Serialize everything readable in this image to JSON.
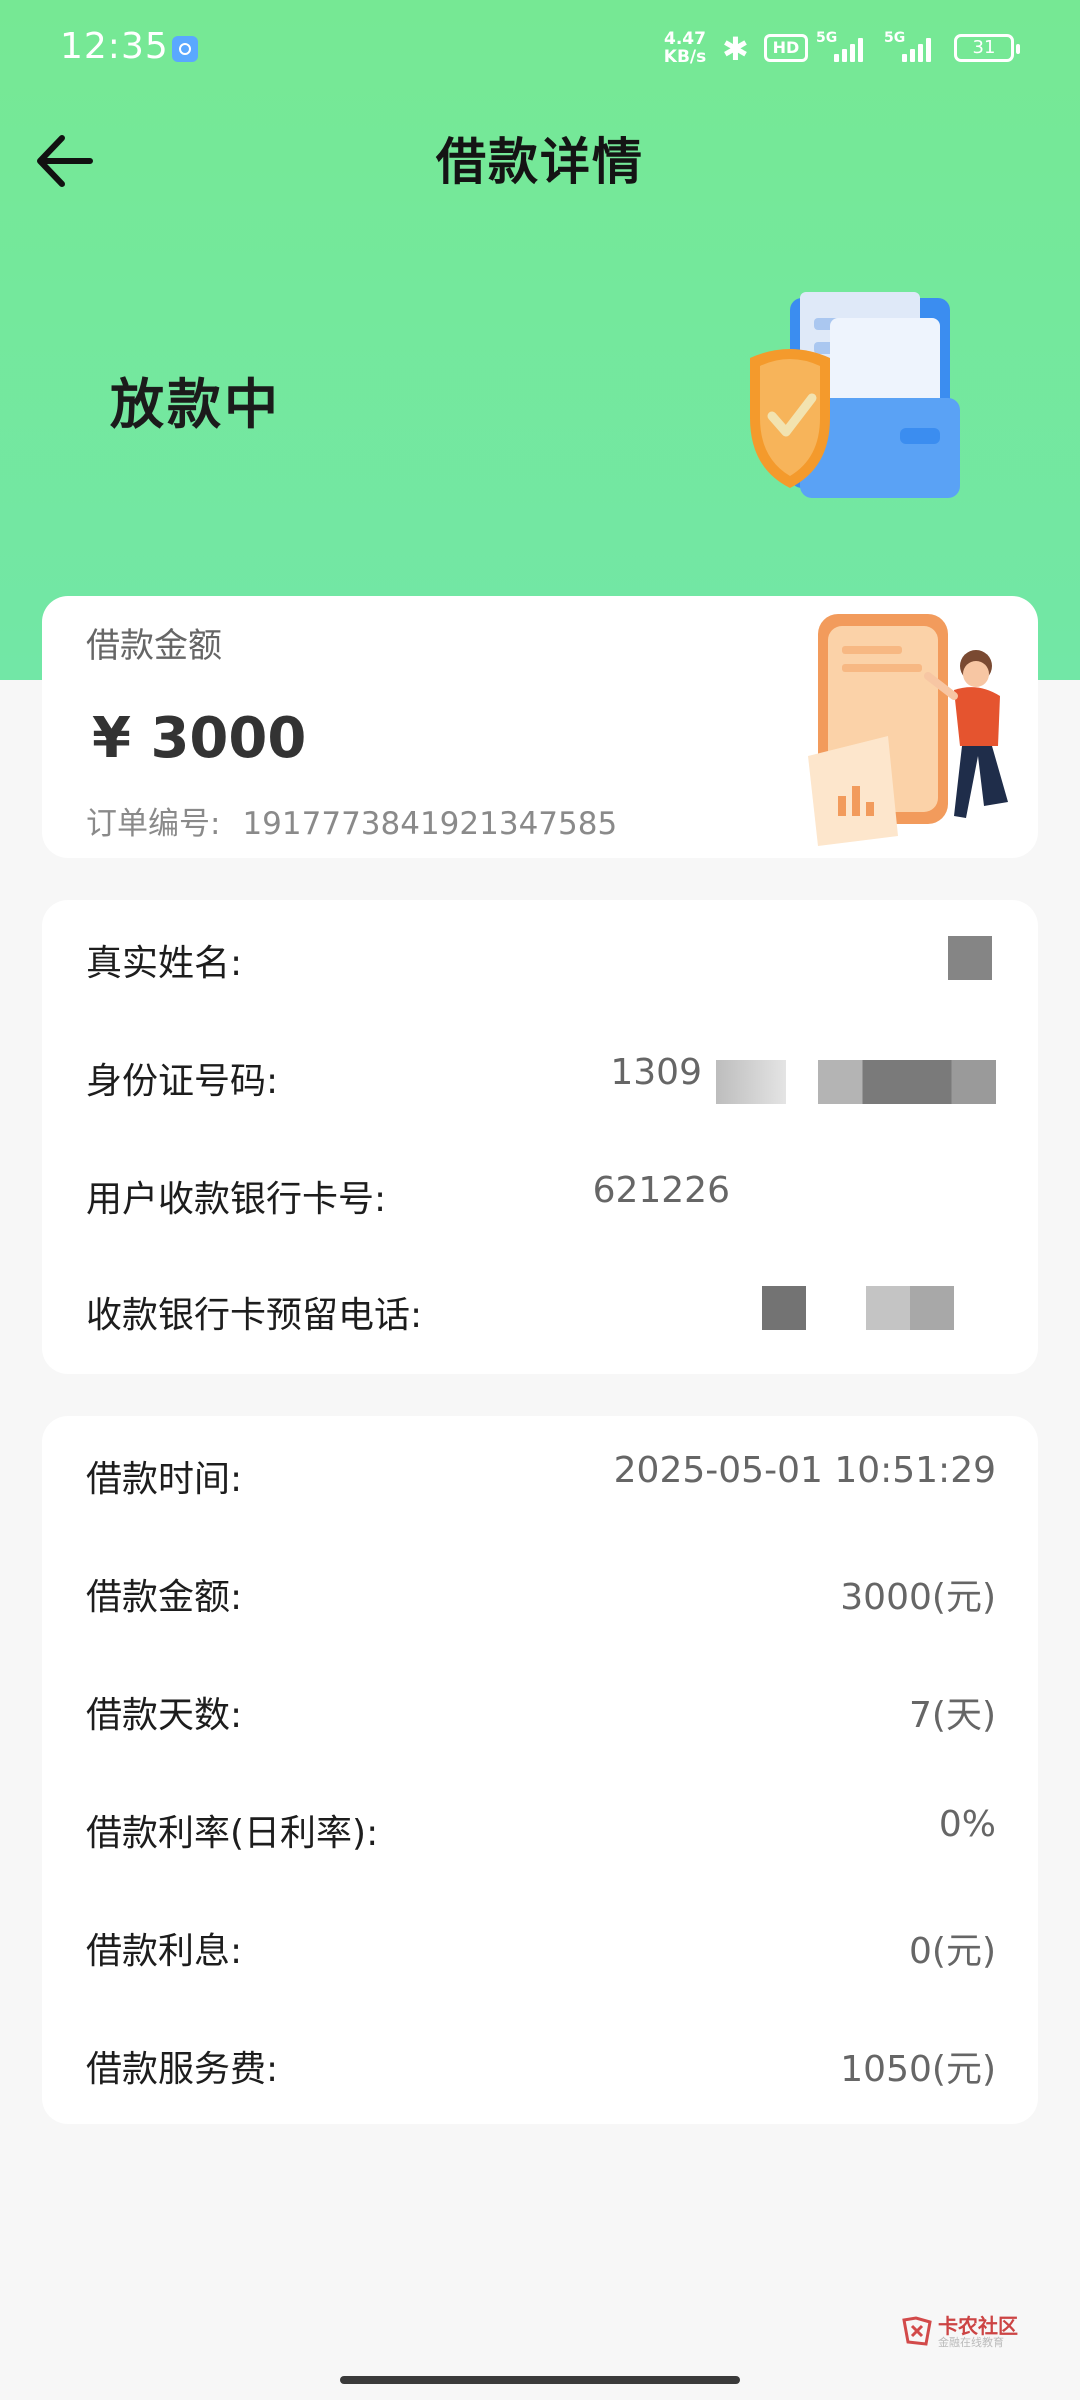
{
  "status_bar": {
    "time": "12:35",
    "net_speed_value": "4.47",
    "net_speed_unit": "KB/s",
    "hd_label": "HD",
    "signal1_label": "5G",
    "signal2_label": "5G",
    "battery": "31",
    "icons": [
      "app-notification-icon",
      "bluetooth-icon",
      "hd-voice-icon",
      "signal-icon",
      "battery-icon"
    ]
  },
  "header": {
    "title": "借款详情",
    "back_icon": "arrow-left-icon"
  },
  "hero": {
    "status": "放款中",
    "illustration": "shield-folder-illustration"
  },
  "amount_card": {
    "label": "借款金额",
    "amount": "¥ 3000",
    "order_label": "订单编号:",
    "order_number": "1917773841921347585",
    "illustration": "phone-person-illustration"
  },
  "user_info": {
    "name_label": "真实姓名:",
    "id_label": "身份证号码:",
    "id_value": "1309",
    "bank_card_label": "用户收款银行卡号:",
    "bank_card_value": "621226",
    "phone_label": "收款银行卡预留电话:"
  },
  "loan_info": {
    "rows": [
      {
        "label": "借款时间:",
        "value": "2025-05-01 10:51:29"
      },
      {
        "label": "借款金额:",
        "value": "3000(元)"
      },
      {
        "label": "借款天数:",
        "value": "7(天)"
      },
      {
        "label": "借款利率(日利率):",
        "value": "0%"
      },
      {
        "label": "借款利息:",
        "value": "0(元)"
      },
      {
        "label": "借款服务费:",
        "value": "1050(元)"
      }
    ]
  },
  "watermark": {
    "title": "卡农社区",
    "subtitle": "金融在线教育"
  },
  "colors": {
    "hero_green": "#76e894",
    "card_bg": "#ffffff",
    "page_bg": "#f7f7f7"
  }
}
